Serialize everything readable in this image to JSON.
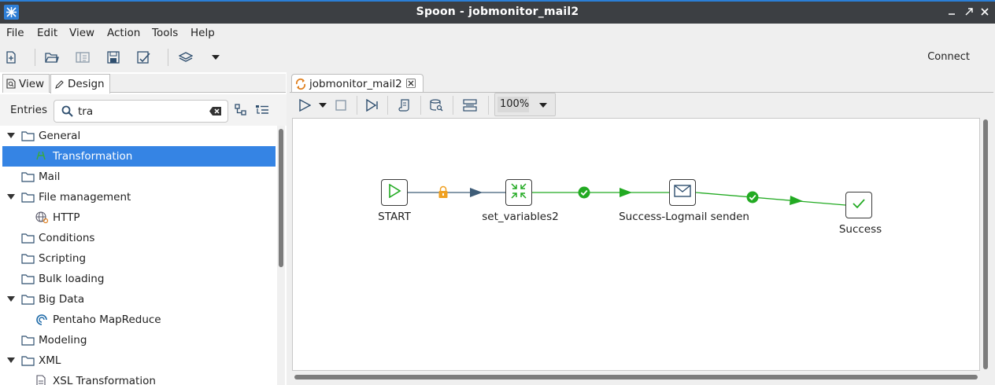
{
  "window": {
    "title": "Spoon - jobmonitor_mail2"
  },
  "menu": [
    "File",
    "Edit",
    "View",
    "Action",
    "Tools",
    "Help"
  ],
  "toolbar": {
    "connect_label": "Connect"
  },
  "left_panel": {
    "tabs": [
      {
        "label": "View"
      },
      {
        "label": "Design"
      }
    ],
    "entries_label": "Entries",
    "search_value": "tra",
    "tree": [
      {
        "label": "General",
        "level": 0,
        "expanded": true
      },
      {
        "label": "Transformation",
        "level": 1,
        "selected": true
      },
      {
        "label": "Mail",
        "level": 0
      },
      {
        "label": "File management",
        "level": 0,
        "expanded": true
      },
      {
        "label": "HTTP",
        "level": 1
      },
      {
        "label": "Conditions",
        "level": 0
      },
      {
        "label": "Scripting",
        "level": 0
      },
      {
        "label": "Bulk loading",
        "level": 0
      },
      {
        "label": "Big Data",
        "level": 0,
        "expanded": true
      },
      {
        "label": "Pentaho MapReduce",
        "level": 1
      },
      {
        "label": "Modeling",
        "level": 0
      },
      {
        "label": "XML",
        "level": 0,
        "expanded": true
      },
      {
        "label": "XSL Transformation",
        "level": 1
      }
    ]
  },
  "editor": {
    "tab_label": "jobmonitor_mail2",
    "zoom": "100%",
    "nodes": [
      {
        "label": "START",
        "icon": "play-icon"
      },
      {
        "label": "set_variables2",
        "icon": "variables-icon"
      },
      {
        "label": "Success-Logmail senden",
        "icon": "mail-icon"
      },
      {
        "label": "Success",
        "icon": "check-icon"
      }
    ],
    "hops": [
      {
        "from": "START",
        "to": "set_variables2",
        "type": "unconditional"
      },
      {
        "from": "set_variables2",
        "to": "Success-Logmail senden",
        "type": "success"
      },
      {
        "from": "Success-Logmail senden",
        "to": "Success",
        "type": "success"
      }
    ]
  },
  "colors": {
    "selection": "#3584e4",
    "title_bar": "#3c3f43",
    "hop_success": "#22aa22",
    "hop_unconditional": "#3f5d78",
    "lock": "#f0a020"
  }
}
